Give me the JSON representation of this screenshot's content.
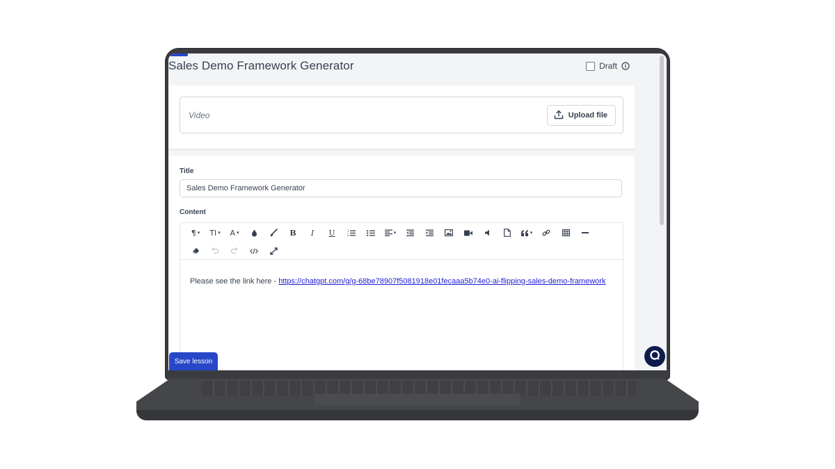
{
  "header": {
    "title": "Sales Demo Framework Generator",
    "draft_label": "Draft"
  },
  "video": {
    "label": "Video",
    "upload_label": "Upload file"
  },
  "form": {
    "title_label": "Title",
    "title_value": "Sales Demo Framework Generator",
    "content_label": "Content"
  },
  "toolbar": {
    "row1": [
      "paragraph-format",
      "font-size",
      "font-color",
      "text-color-drop",
      "brush",
      "bold",
      "italic",
      "underline",
      "ordered-list",
      "unordered-list",
      "align",
      "indent-less",
      "indent-more",
      "insert-image",
      "insert-video",
      "insert-audio",
      "insert-file",
      "quote",
      "insert-link",
      "insert-table",
      "horizontal-line"
    ],
    "row2": [
      "clear-formatting",
      "undo",
      "redo",
      "code-view",
      "fullscreen"
    ],
    "glyphs": {
      "bold": "B",
      "italic": "I",
      "underline": "U"
    }
  },
  "content": {
    "text": "Please see the link here - ",
    "link": "https://chatgpt.com/g/g-68be78907f5081918e01fecaaa5b74e0-ai-flipping-sales-demo-framework"
  },
  "footer": {
    "save_label": "Save lesson"
  },
  "colors": {
    "accent": "#2747c8",
    "link": "#1d1dd4",
    "chat_bubble": "#0f1b4d"
  }
}
